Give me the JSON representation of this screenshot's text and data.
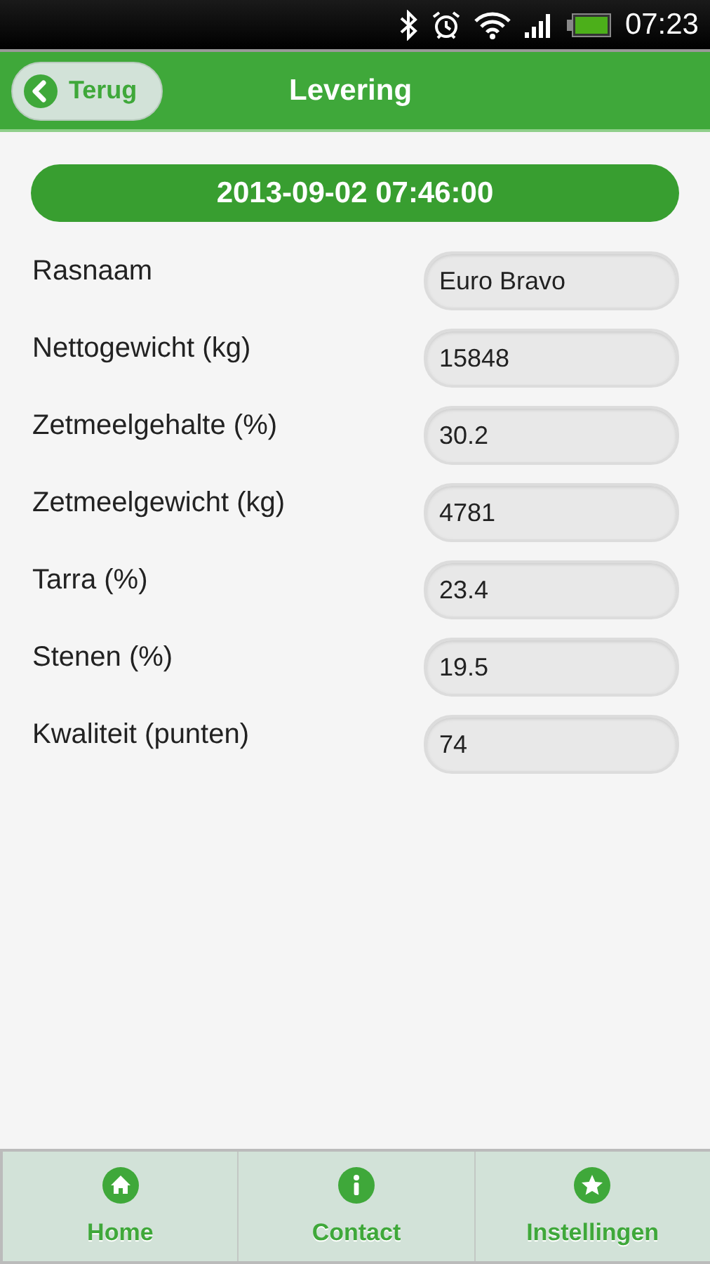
{
  "status_bar": {
    "time": "07:23"
  },
  "header": {
    "back_label": "Terug",
    "title": "Levering"
  },
  "date_banner": "2013-09-02 07:46:00",
  "fields": [
    {
      "label": "Rasnaam",
      "value": "Euro Bravo"
    },
    {
      "label": "Nettogewicht (kg)",
      "value": "15848"
    },
    {
      "label": "Zetmeelgehalte (%)",
      "value": "30.2"
    },
    {
      "label": "Zetmeelgewicht (kg)",
      "value": "4781"
    },
    {
      "label": "Tarra (%)",
      "value": "23.4"
    },
    {
      "label": "Stenen (%)",
      "value": "19.5"
    },
    {
      "label": "Kwaliteit (punten)",
      "value": "74"
    }
  ],
  "nav": [
    {
      "kind": "home",
      "label": "Home"
    },
    {
      "kind": "info",
      "label": "Contact"
    },
    {
      "kind": "star",
      "label": "Instellingen"
    }
  ]
}
